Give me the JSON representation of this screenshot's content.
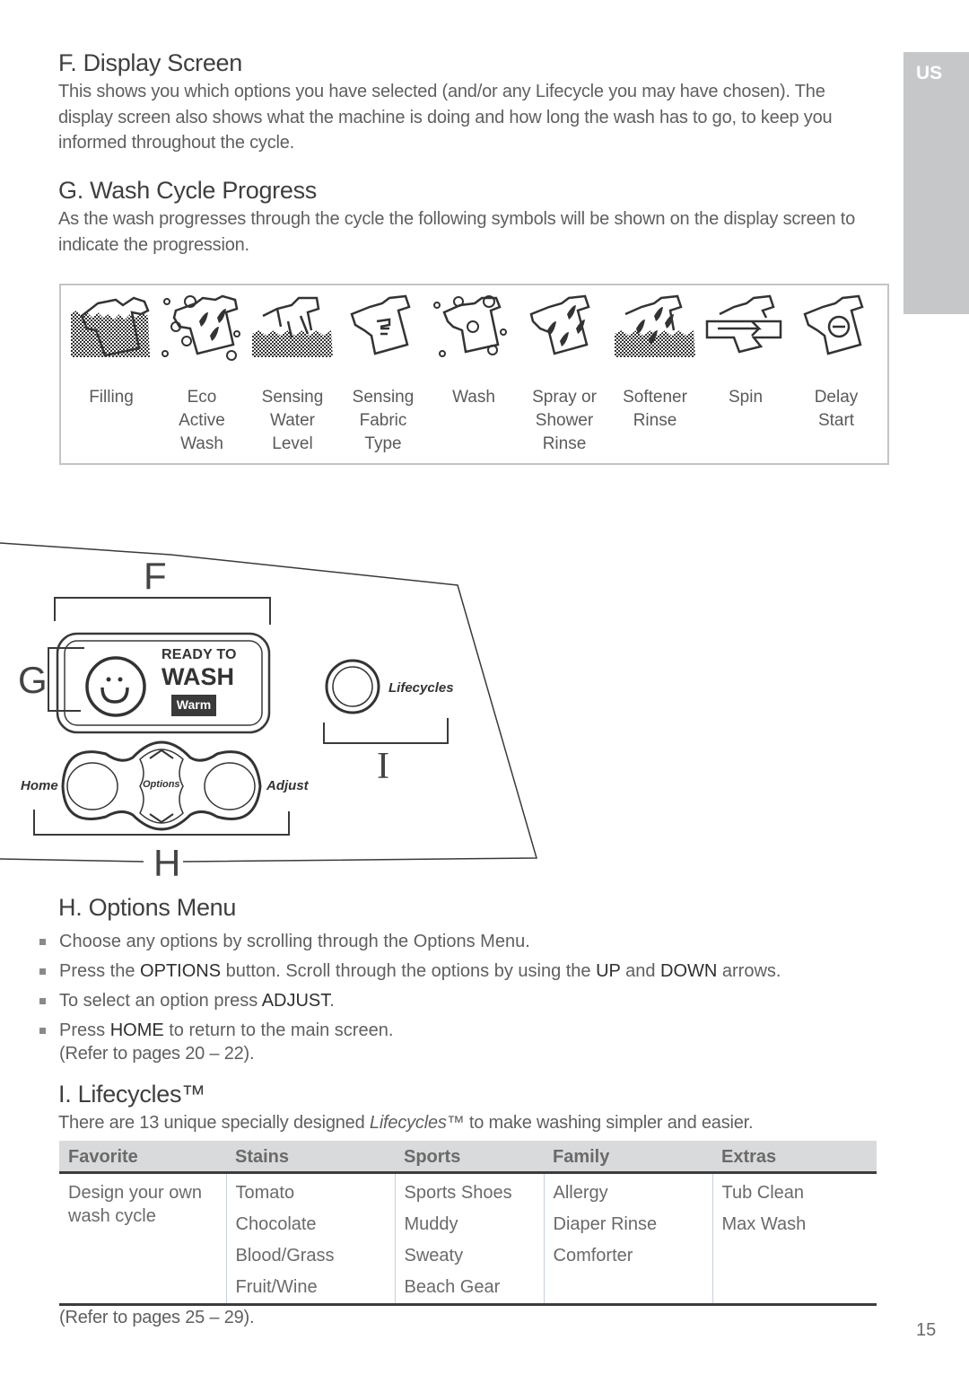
{
  "tab": {
    "label": "US"
  },
  "section_f": {
    "heading": "F. Display Screen",
    "body": "This shows you which options you have selected (and/or any Lifecycle you may have chosen). The display screen also shows what the machine is doing and how long the wash has to go, to keep you informed throughout the cycle."
  },
  "section_g": {
    "heading": "G. Wash Cycle Progress",
    "body": "As the wash progresses through the cycle the following symbols will be shown on the display screen to indicate the progression.",
    "symbols": [
      {
        "icon": "filling-icon",
        "label": "Filling"
      },
      {
        "icon": "eco-active-wash-icon",
        "label": "Eco\nActive\nWash"
      },
      {
        "icon": "sensing-water-level-icon",
        "label": "Sensing\nWater\nLevel"
      },
      {
        "icon": "sensing-fabric-type-icon",
        "label": "Sensing\nFabric\nType"
      },
      {
        "icon": "wash-icon",
        "label": "Wash"
      },
      {
        "icon": "spray-shower-rinse-icon",
        "label": "Spray or\nShower\nRinse"
      },
      {
        "icon": "softener-rinse-icon",
        "label": "Softener\nRinse"
      },
      {
        "icon": "spin-icon",
        "label": "Spin"
      },
      {
        "icon": "delay-start-icon",
        "label": "Delay\nStart"
      }
    ]
  },
  "panel": {
    "callouts": {
      "f": "F",
      "g": "G",
      "h": "H",
      "i": "I"
    },
    "display": {
      "line1": "READY TO",
      "line2": "WASH",
      "badge": "Warm"
    },
    "buttons": {
      "home": "Home",
      "options": "Options",
      "adjust": "Adjust",
      "lifecycles": "Lifecycles"
    }
  },
  "section_h": {
    "heading": "H. Options Menu",
    "bullets": [
      {
        "parts": [
          "Choose any options by scrolling through the Options Menu."
        ]
      },
      {
        "parts": [
          "Press the ",
          "OPTIONS",
          " button. Scroll through the options by using the ",
          "UP",
          " and ",
          "DOWN",
          " arrows."
        ]
      },
      {
        "parts": [
          "To select an option press ",
          "ADJUST",
          "."
        ]
      },
      {
        "parts": [
          "Press ",
          "HOME",
          " to return to the main screen."
        ]
      }
    ],
    "refer": "(Refer to pages 20 – 22)."
  },
  "section_i": {
    "heading": "I. Lifecycles™",
    "intro_before": "There are 13 unique specially designed ",
    "intro_italic": "Lifecycles™",
    "intro_after": " to make washing simpler and easier.",
    "table": {
      "headers": [
        "Favorite",
        "Stains",
        "Sports",
        "Family",
        "Extras"
      ],
      "columns": [
        [
          "Design your own wash cycle"
        ],
        [
          "Tomato",
          "Chocolate",
          "Blood/Grass",
          "Fruit/Wine"
        ],
        [
          "Sports Shoes",
          "Muddy",
          "Sweaty",
          "Beach Gear"
        ],
        [
          "Allergy",
          "Diaper Rinse",
          "Comforter"
        ],
        [
          "Tub Clean",
          "Max Wash"
        ]
      ]
    },
    "refer": "(Refer to pages 25 – 29)."
  },
  "page_number": "15"
}
